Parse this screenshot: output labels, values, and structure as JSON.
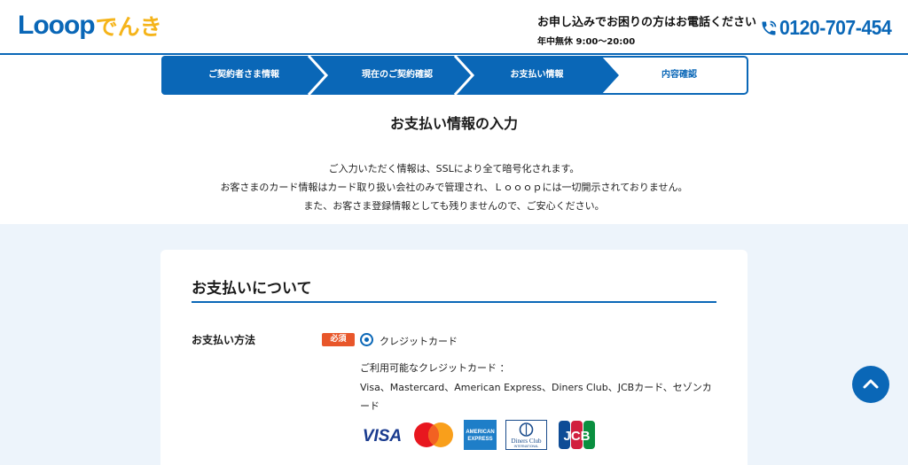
{
  "header": {
    "logo_main": "Looop",
    "logo_sub": "でんき",
    "contact_lead": "お申し込みでお困りの方はお電話ください",
    "contact_hours": "年中無休 9:00〜20:00",
    "phone_number": "0120-707-454"
  },
  "steps": [
    {
      "label": "ご契約者さま情報",
      "state": "done"
    },
    {
      "label": "現在のご契約確認",
      "state": "done"
    },
    {
      "label": "お支払い情報",
      "state": "active"
    },
    {
      "label": "内容確認",
      "state": "upcoming"
    }
  ],
  "intro": {
    "title": "お支払い情報の入力",
    "line1": "ご入力いただく情報は、SSLにより全て暗号化されます。",
    "line2": "お客さまのカード情報はカード取り扱い会社のみで管理され、Ｌｏｏｏｐには一切開示されておりません。",
    "line3": "また、お客さま登録情報としても残りませんので、ご安心ください。"
  },
  "payment": {
    "section_title": "お支払いについて",
    "field_label": "お支払い方法",
    "required_badge": "必須",
    "option_label": "クレジットカード",
    "option_selected": true,
    "cards_heading": "ご利用可能なクレジットカード ：",
    "cards_list": "Visa、Mastercard、American Express、Diners Club、JCBカード、セゾンカード",
    "brands": [
      "VISA",
      "Mastercard",
      "AMERICAN EXPRESS",
      "Diners Club INTERNATIONAL",
      "JCB"
    ]
  },
  "colors": {
    "brand_blue": "#0a67b7",
    "brand_yellow": "#f5b41a",
    "required_orange": "#e8562a",
    "lower_bg": "#edf4fb"
  },
  "icons": [
    "phone-icon",
    "chevron-up-icon"
  ]
}
